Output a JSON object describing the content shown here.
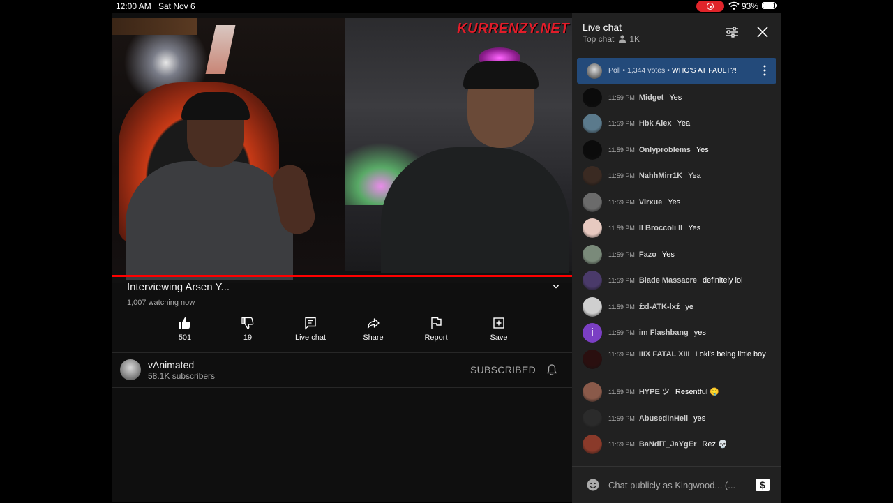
{
  "status_bar": {
    "time": "12:00 AM",
    "date": "Sat Nov 6",
    "battery": "93%"
  },
  "video": {
    "watermark": "KURRENZY.NET",
    "title": "Interviewing Arsen Y...",
    "watching": "1,007 watching now",
    "progress_color": "#ff0000"
  },
  "actions": [
    {
      "label": "501",
      "icon": "thumbs-up-icon"
    },
    {
      "label": "19",
      "icon": "thumbs-down-icon"
    },
    {
      "label": "Live chat",
      "icon": "live-chat-icon"
    },
    {
      "label": "Share",
      "icon": "share-icon"
    },
    {
      "label": "Report",
      "icon": "flag-icon"
    },
    {
      "label": "Save",
      "icon": "save-icon"
    }
  ],
  "channel": {
    "name": "vAnimated",
    "subscribers": "58.1K subscribers",
    "subscribed_label": "SUBSCRIBED"
  },
  "chat": {
    "title": "Live chat",
    "mode": "Top chat",
    "viewers": "1K",
    "poll": {
      "prefix": "Poll • 1,344 votes • ",
      "question": "WHO'S AT FAULT?!"
    },
    "messages": [
      {
        "time": "11:59 PM",
        "author": "Midget",
        "text": "Yes",
        "avatar_color": "#0b0b0b"
      },
      {
        "time": "11:59 PM",
        "author": "Hbk Alex",
        "text": "Yea",
        "avatar_color": "#5b7a8c"
      },
      {
        "time": "11:59 PM",
        "author": "Onlyproblems",
        "text": "Yes",
        "avatar_color": "#0b0b0b"
      },
      {
        "time": "11:59 PM",
        "author": "NahhMirr1K",
        "text": "Yea",
        "avatar_color": "#3a2a22"
      },
      {
        "time": "11:59 PM",
        "author": "Virxue",
        "text": "Yes",
        "avatar_color": "#6b6b6b"
      },
      {
        "time": "11:59 PM",
        "author": "Il Broccoli II",
        "text": "Yes",
        "avatar_color": "#e7c9c0"
      },
      {
        "time": "11:59 PM",
        "author": "Fazo",
        "text": "Yes",
        "avatar_color": "#7a8a7a"
      },
      {
        "time": "11:59 PM",
        "author": "Blade Massacre",
        "text": "definitely lol",
        "avatar_color": "#4a3a6a"
      },
      {
        "time": "11:59 PM",
        "author": "źxl-ATK-lxź",
        "text": "ye",
        "avatar_color": "#cfcfcf"
      },
      {
        "time": "11:59 PM",
        "author": "im Flashbang",
        "text": "yes",
        "avatar_color": "#7b3fc4",
        "avatar_letter": "i"
      },
      {
        "time": "11:59 PM",
        "author": "IIIX FATAL XIII",
        "text": "Loki's being little boy",
        "avatar_color": "#2a0f0f"
      },
      {
        "time": "11:59 PM",
        "author": "HYPE ツ",
        "text": "Resentful 🤤",
        "avatar_color": "#8a5a4a"
      },
      {
        "time": "11:59 PM",
        "author": "AbusedInHell",
        "text": "yes",
        "avatar_color": "#2b2b2b"
      },
      {
        "time": "11:59 PM",
        "author": "BaNdiT_JaYgEr",
        "text": "Rez 💀",
        "avatar_color": "#8a3a2a"
      }
    ],
    "input_placeholder": "Chat publicly as Kingwood... (..."
  }
}
